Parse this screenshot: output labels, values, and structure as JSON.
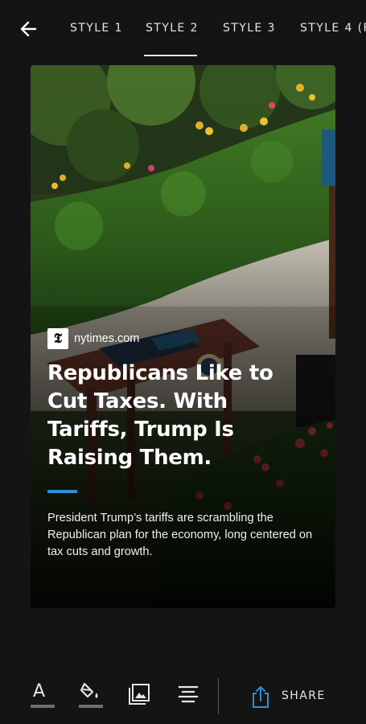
{
  "tabs": [
    {
      "label": "STYLE 1"
    },
    {
      "label": "STYLE 2",
      "selected": true
    },
    {
      "label": "STYLE 3"
    },
    {
      "label": "STYLE 4 (F"
    }
  ],
  "card": {
    "source_logo": "𝕿",
    "source": "nytimes.com",
    "headline": "Republicans Like to Cut Taxes. With Tariffs, Trump Is Raising Them.",
    "summary": "President Trump’s tariffs are scrambling the Republican plan for the economy, long centered on tax cuts and growth.",
    "accent_color": "#2f8fd1"
  },
  "toolbar": {
    "text_tool_glyph": "A",
    "share_label": "SHARE"
  },
  "icons": [
    "back-arrow-icon",
    "text-format-icon",
    "fill-color-icon",
    "image-gallery-icon",
    "align-center-icon",
    "share-icon"
  ]
}
